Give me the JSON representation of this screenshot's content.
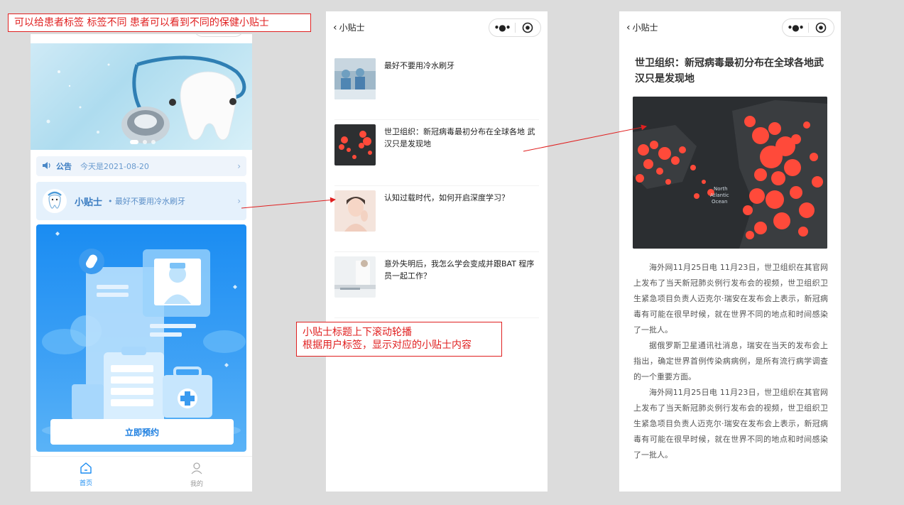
{
  "annotations": {
    "note1": "可以给患者标签 标签不同 患者可以看到不同的保健小贴士",
    "note2_line1": "小贴士标题上下滚动轮播",
    "note2_line2": "根据用户标签，显示对应的小贴士内容"
  },
  "home": {
    "notice_label": "公告",
    "notice_text": "今天是2021-08-20",
    "tips_title": "小贴士",
    "tips_text": "• 最好不要用冷水刷牙",
    "booking_button": "立即预约",
    "tabs": [
      {
        "label": "首页",
        "active": true
      },
      {
        "label": "我的",
        "active": false
      }
    ]
  },
  "tips_list": {
    "back_label": "小贴士",
    "items": [
      {
        "title": "最好不要用冷水刷牙"
      },
      {
        "title": "世卫组织：新冠病毒最初分布在全球各地 武汉只是发现地"
      },
      {
        "title": "认知过载时代，如何开启深度学习？"
      },
      {
        "title": "意外失明后，我怎么学会变成并跟BAT 程序员一起工作？"
      }
    ]
  },
  "article": {
    "back_label": "小贴士",
    "title": "世卫组织：新冠病毒最初分布在全球各地武汉只是发现地",
    "map_label": "North Atlantic Ocean",
    "paragraphs": [
      "海外网11月25日电 11月23日，世卫组织在其官网上发布了当天新冠肺炎例行发布会的视频，世卫组织卫生紧急项目负责人迈克尔·瑞安在发布会上表示，新冠病毒有可能在很早时候，就在世界不同的地点和时间感染了一批人。",
      "据俄罗斯卫星通讯社消息，瑞安在当天的发布会上指出，确定世界首例传染病病例，是所有流行病学调查的一个重要方面。",
      "海外网11月25日电 11月23日，世卫组织在其官网上发布了当天新冠肺炎例行发布会的视频，世卫组织卫生紧急项目负责人迈克尔·瑞安在发布会上表示，新冠病毒有可能在很早时候，就在世界不同的地点和时间感染了一批人。"
    ]
  },
  "colors": {
    "accent": "#1a8cf2",
    "annotation": "#e02020",
    "map_dot": "#ff4a3a"
  }
}
